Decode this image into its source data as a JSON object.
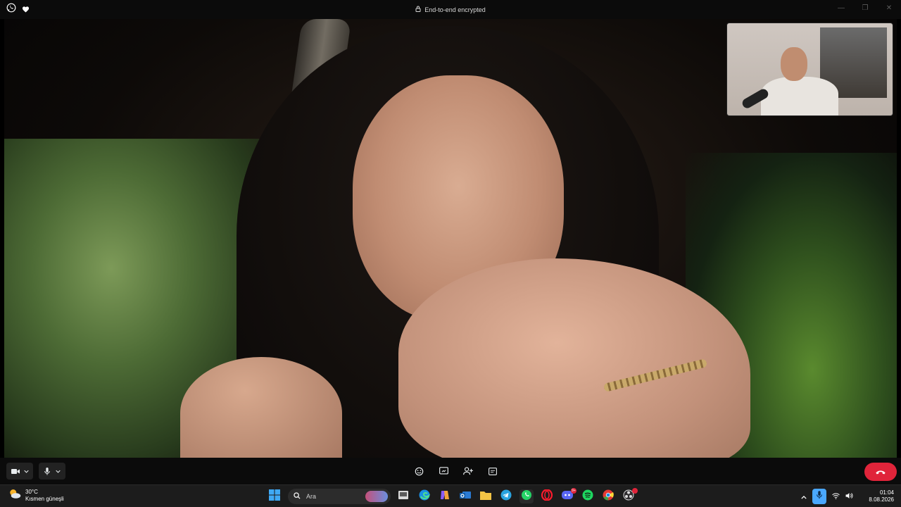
{
  "titlebar": {
    "encryption_label": "End-to-end encrypted",
    "icons": [
      "whatsapp-icon",
      "heart-icon",
      "lock-icon"
    ],
    "window_controls": [
      "minimize-icon",
      "maximize-icon",
      "close-icon"
    ]
  },
  "call": {
    "controls_left": [
      "video-camera-icon",
      "chevron-down-icon",
      "microphone-icon",
      "chevron-down-icon"
    ],
    "controls_center": [
      "emoji-icon",
      "screen-share-icon",
      "add-participant-icon",
      "more-options-icon"
    ],
    "end_call_icon": "end-call-icon",
    "end_call_color": "#e0243a"
  },
  "taskbar": {
    "weather": {
      "temperature": "30°C",
      "condition": "Kısmen güneşli",
      "icon": "partly-sunny-icon"
    },
    "search": {
      "placeholder": "Ara"
    },
    "apps": [
      "windows-start-icon",
      "file-explorer-icon",
      "edge-icon",
      "copilot-icon",
      "outlook-icon",
      "folder-icon",
      "telegram-icon",
      "whatsapp-icon",
      "opera-icon",
      "discord-icon",
      "spotify-icon",
      "chrome-icon",
      "obs-icon"
    ],
    "discord_badge": "9+",
    "tray": {
      "icons": [
        "chevron-up-icon",
        "microphone-active-icon",
        "wifi-icon",
        "volume-icon"
      ],
      "time": "01:04",
      "date": "8.08.2026"
    }
  }
}
